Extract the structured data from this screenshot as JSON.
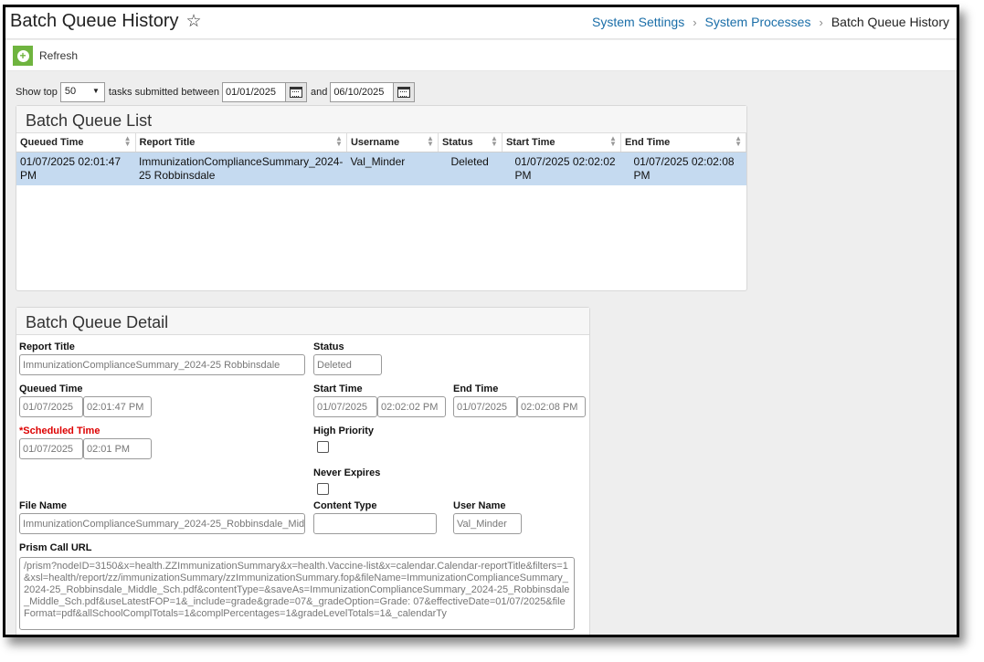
{
  "header": {
    "title": "Batch Queue History",
    "breadcrumb": [
      "System Settings",
      "System Processes",
      "Batch Queue History"
    ]
  },
  "toolbar": {
    "refresh_label": "Refresh"
  },
  "filter": {
    "show_top_label": "Show top",
    "top_count": "50",
    "between_label": "tasks submitted between",
    "start_date": "01/01/2025",
    "and_label": "and",
    "end_date": "06/10/2025"
  },
  "list": {
    "title": "Batch Queue List",
    "columns": [
      "Queued Time",
      "Report Title",
      "Username",
      "Status",
      "Start Time",
      "End Time"
    ],
    "rows": [
      {
        "queued_time": "01/07/2025 02:01:47 PM",
        "report_title": "ImmunizationComplianceSummary_2024-25 Robbinsdale",
        "username": "Val_Minder",
        "status": "Deleted",
        "start_time": "01/07/2025 02:02:02 PM",
        "end_time": "01/07/2025 02:02:08 PM"
      }
    ]
  },
  "detail": {
    "title": "Batch Queue Detail",
    "report_title_label": "Report Title",
    "report_title": "ImmunizationComplianceSummary_2024-25 Robbinsdale",
    "status_label": "Status",
    "status": "Deleted",
    "queued_time_label": "Queued Time",
    "queued_date": "01/07/2025",
    "queued_time": "02:01:47 PM",
    "start_time_label": "Start Time",
    "start_date": "01/07/2025",
    "start_time": "02:02:02 PM",
    "end_time_label": "End Time",
    "end_date": "01/07/2025",
    "end_time": "02:02:08 PM",
    "scheduled_time_label": "Scheduled Time",
    "scheduled_date": "01/07/2025",
    "scheduled_time": "02:01 PM",
    "high_priority_label": "High Priority",
    "never_expires_label": "Never Expires",
    "file_name_label": "File Name",
    "file_name": "ImmunizationComplianceSummary_2024-25_Robbinsdale_Midd",
    "content_type_label": "Content Type",
    "content_type": "",
    "user_name_label": "User Name",
    "user_name": "Val_Minder",
    "prism_url_label": "Prism Call URL",
    "prism_url": "/prism?nodeID=3150&x=health.ZZImmunizationSummary&x=health.Vaccine-list&x=calendar.Calendar-reportTitle&filters=1&xsl=health/report/zz/immunizationSummary/zzImmunizationSummary.fop&fileName=ImmunizationComplianceSummary_2024-25_Robbinsdale_Middle_Sch.pdf&contentType=&saveAs=ImmunizationComplianceSummary_2024-25_Robbinsdale_Middle_Sch.pdf&useLatestFOP=1&_include=grade&grade=07&_gradeOption=Grade: 07&effectiveDate=01/07/2025&fileFormat=pdf&allSchoolComplTotals=1&complPercentages=1&gradeLevelTotals=1&_calendarTy"
  }
}
